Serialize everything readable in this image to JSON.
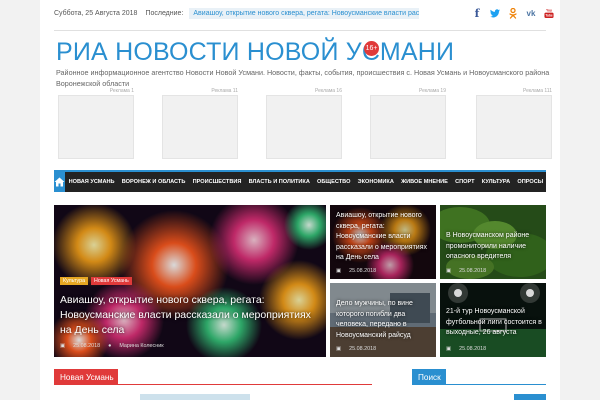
{
  "topbar": {
    "date": "Суббота, 25 Августа 2018",
    "latest_label": "Последние:",
    "ticker": "Авиашоу, открытие нового сквера, регата: Новоусманские власти рассказали о"
  },
  "socials": [
    {
      "name": "facebook-icon",
      "glyph": "f",
      "color": "#3b5998"
    },
    {
      "name": "twitter-icon",
      "glyph": "🐦",
      "color": "#1da1f2"
    },
    {
      "name": "odnoklassniki-icon",
      "glyph": "ok",
      "color": "#ee8208"
    },
    {
      "name": "vk-icon",
      "glyph": "vk",
      "color": "#4c75a3"
    },
    {
      "name": "youtube-icon",
      "glyph": "▶",
      "color": "#cd201f"
    }
  ],
  "header": {
    "title": "РИА НОВОСТИ НОВОЙ УСМАНИ",
    "age_badge": "16+",
    "tagline": "Районное информационное агентство Новости Новой Усмани. Новости, факты, события, происшествия с. Новая Усмань и Новоусманского района Воронежской области"
  },
  "ads": [
    "Реклама 1",
    "Реклама 11",
    "Реклама 16",
    "Реклама 19",
    "Реклама 111"
  ],
  "nav": [
    "Новая Усмань",
    "Воронеж и область",
    "Происшествия",
    "Власть и политика",
    "Общество",
    "Экономика",
    "Живое мнение",
    "Спорт",
    "Культура",
    "Опросы"
  ],
  "featured": {
    "big": {
      "tags": [
        "Культура",
        "Новая Усмань"
      ],
      "title": "Авиашоу, открытие нового сквера, регата: Новоусманские власти рассказали о мероприятиях на День села",
      "date": "25.08.2018",
      "author": "Марина Колесник"
    },
    "small": [
      {
        "title": "Авиашоу, открытие нового сквера, регата: Новоусманские власти рассказали о мероприятиях на День села",
        "date": "25.08.2018"
      },
      {
        "title": "В Новоусманском районе промониторили наличие опасного вредителя",
        "date": "25.08.2018"
      },
      {
        "title": "Дело мужчины, по вине которого погибли два человека, передано в Новоусманский райсуд",
        "date": "25.08.2018"
      },
      {
        "title": "21-й тур Новоусманской футбольной лиги состоится в выходные, 26 августа",
        "date": "25.08.2018"
      }
    ]
  },
  "sections": {
    "left": {
      "label": "Новая Усмань",
      "color": "#e03a3a"
    },
    "right": {
      "label": "Поиск",
      "color": "#2a8fd0"
    }
  }
}
